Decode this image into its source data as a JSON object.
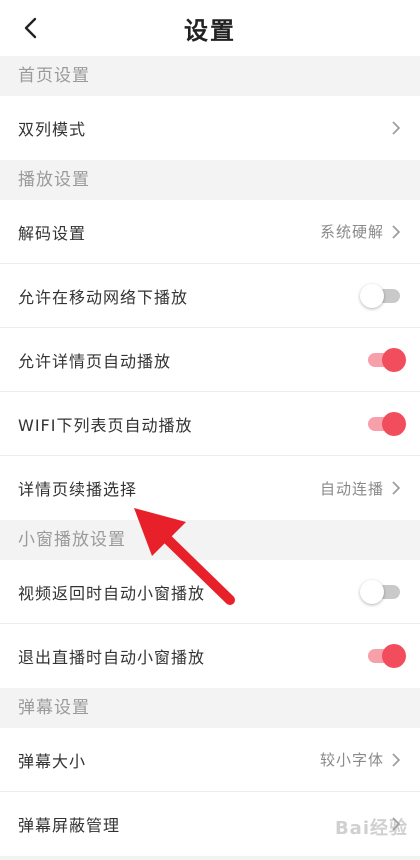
{
  "header": {
    "title": "设置",
    "back_icon": "chevron-left-icon"
  },
  "sections": [
    {
      "title": "首页设置",
      "items": [
        {
          "label": "双列模式",
          "value": "",
          "control": "chevron"
        }
      ]
    },
    {
      "title": "播放设置",
      "items": [
        {
          "label": "解码设置",
          "value": "系统硬解",
          "control": "chevron"
        },
        {
          "label": "允许在移动网络下播放",
          "control": "toggle",
          "state": "off"
        },
        {
          "label": "允许详情页自动播放",
          "control": "toggle",
          "state": "on"
        },
        {
          "label": "WIFI下列表页自动播放",
          "control": "toggle",
          "state": "on"
        },
        {
          "label": "详情页续播选择",
          "value": "自动连播",
          "control": "chevron"
        }
      ]
    },
    {
      "title": "小窗播放设置",
      "items": [
        {
          "label": "视频返回时自动小窗播放",
          "control": "toggle",
          "state": "off"
        },
        {
          "label": "退出直播时自动小窗播放",
          "control": "toggle",
          "state": "on"
        }
      ]
    },
    {
      "title": "弹幕设置",
      "items": [
        {
          "label": "弹幕大小",
          "value": "较小字体",
          "control": "chevron"
        },
        {
          "label": "弹幕屏蔽管理",
          "value": "",
          "control": "chevron"
        }
      ]
    }
  ],
  "watermark": {
    "text": "Bai经验"
  },
  "colors": {
    "accent": "#f24d5c",
    "accent_track": "#f7a0aa",
    "toggle_off_track": "#c9c9c9",
    "section_text": "#9a9a9a",
    "annotation_arrow": "#e8202a"
  }
}
